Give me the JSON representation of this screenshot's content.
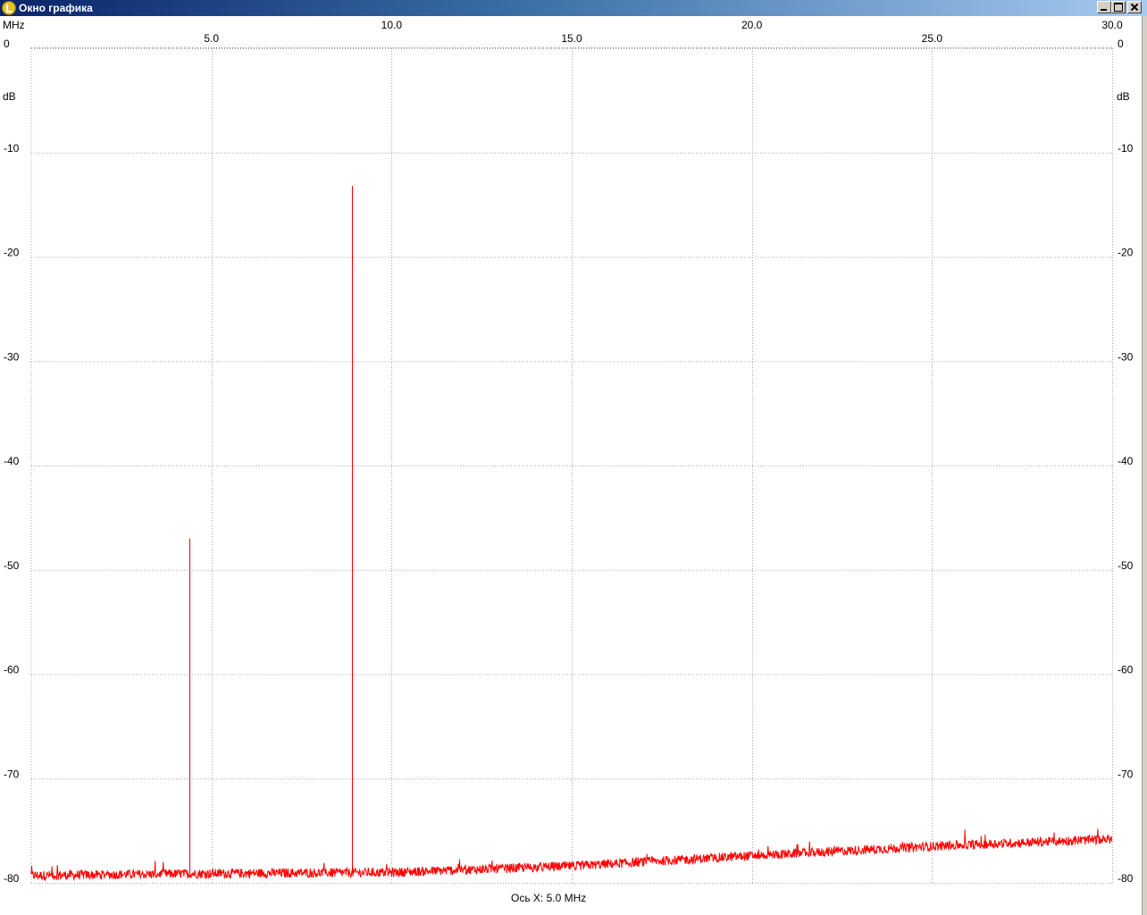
{
  "window": {
    "title": "Окно графика",
    "icon": "app-logo-icon",
    "buttons": [
      "minimize-icon",
      "maximize-icon",
      "close-icon"
    ]
  },
  "status": {
    "x_axis_step": "Ось X: 5.0 MHz"
  },
  "chart_data": {
    "type": "line",
    "title": "",
    "xlabel": "MHz",
    "ylabel": "dB",
    "xlim": [
      0.0,
      30.0
    ],
    "ylim": [
      -80,
      0
    ],
    "x_ticks_top_row": [
      "10.0",
      "20.0",
      "30.0"
    ],
    "x_ticks_bottom_row": [
      "5.0",
      "15.0",
      "25.0"
    ],
    "x_tick_values": [
      5.0,
      10.0,
      15.0,
      20.0,
      25.0,
      30.0
    ],
    "y_ticks": [
      "0",
      "-10",
      "-20",
      "-30",
      "-40",
      "-50",
      "-60",
      "-70",
      "-80"
    ],
    "y_tick_values": [
      0,
      -10,
      -20,
      -30,
      -40,
      -50,
      -60,
      -70,
      -80
    ],
    "y_axis_both_sides": true,
    "grid": true,
    "grid_style": "dotted",
    "line_color": "#ff0000",
    "noise_floor": {
      "x": [
        0.0,
        5.0,
        10.0,
        15.0,
        20.0,
        25.0,
        30.0
      ],
      "y": [
        -79.3,
        -79.1,
        -79.0,
        -78.4,
        -77.4,
        -76.5,
        -75.8
      ]
    },
    "peaks": [
      {
        "x": 4.4,
        "y": -47.0
      },
      {
        "x": 8.9,
        "y": -13.2
      }
    ]
  }
}
